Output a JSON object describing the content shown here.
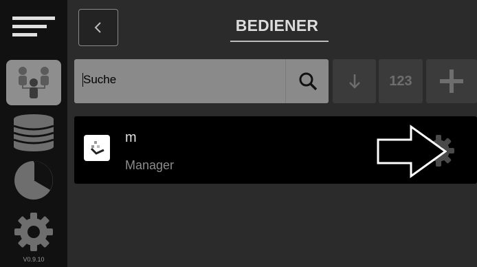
{
  "sidebar": {
    "items": [
      {
        "name": "menu",
        "icon": "menu-icon"
      },
      {
        "name": "users",
        "icon": "users-icon",
        "active": true
      },
      {
        "name": "database",
        "icon": "database-icon"
      },
      {
        "name": "statistics",
        "icon": "pie-chart-icon"
      },
      {
        "name": "settings",
        "icon": "gear-icon"
      }
    ],
    "version": "V0.9.10"
  },
  "header": {
    "title": "BEDIENER",
    "back_icon": "chevron-left-icon"
  },
  "toolbar": {
    "search_placeholder": "Suche",
    "search_icon": "search-icon",
    "sort_icon": "arrow-down-icon",
    "numeric_label": "123",
    "add_icon": "plus-icon"
  },
  "list": {
    "items": [
      {
        "name": "m",
        "role": "Manager",
        "icon": "settings-gear-icon"
      }
    ]
  },
  "colors": {
    "background": "#2b2b2b",
    "sidebar": "#111111",
    "active_item": "#8e8e8e",
    "search_field": "#8a8a8a",
    "button": "#3b3b3b"
  }
}
